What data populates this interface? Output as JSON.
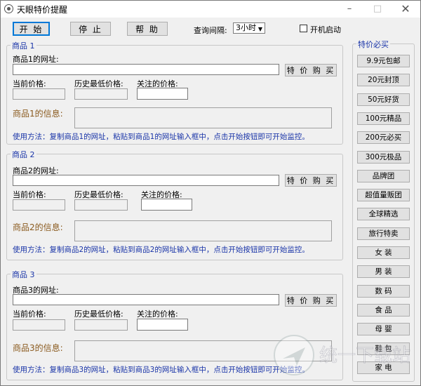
{
  "window": {
    "title": "天眼特价提醒",
    "min": "–",
    "max": "□",
    "close": "✕"
  },
  "toolbar": {
    "start": "开 始",
    "stop": "停 止",
    "help": "帮 助",
    "interval_label": "查询间隔:",
    "interval_value": "3小时",
    "autostart_label": "开机启动",
    "autostart_checked": false
  },
  "products": [
    {
      "legend": "商品 1",
      "url_label": "商品1的网址:",
      "buy_button": "特 价 购 买",
      "current_price_label": "当前价格:",
      "lowest_price_label": "历史最低价格:",
      "watch_price_label": "关注的价格:",
      "info_label": "商品1的信息:",
      "usage": "使用方法：复制商品1的网址，粘贴到商品1的网址输入框中，点击开始按钮即可开始监控。"
    },
    {
      "legend": "商品 2",
      "url_label": "商品2的网址:",
      "buy_button": "特 价 购 买",
      "current_price_label": "当前价格:",
      "lowest_price_label": "历史最低价格:",
      "watch_price_label": "关注的价格:",
      "info_label": "商品2的信息:",
      "usage": "使用方法：复制商品2的网址，粘贴到商品2的网址输入框中，点击开始按钮即可开始监控。"
    },
    {
      "legend": "商品 3",
      "url_label": "商品3的网址:",
      "buy_button": "特 价 购 买",
      "current_price_label": "当前价格:",
      "lowest_price_label": "历史最低价格:",
      "watch_price_label": "关注的价格:",
      "info_label": "商品3的信息:",
      "usage": "使用方法：复制商品3的网址，粘贴到商品3的网址输入框中，点击开始按钮即可开始监控。"
    }
  ],
  "sidebar": {
    "title": "特价必买",
    "items": [
      "9.9元包邮",
      "20元封顶",
      "50元好货",
      "100元精品",
      "200元必买",
      "300元极品",
      "品牌团",
      "超值量贩团",
      "全球精选",
      "旅行特卖",
      "女 装",
      "男 装",
      "数 码",
      "食 品",
      "母 婴",
      "鞋 包",
      "家 电"
    ]
  },
  "watermark": {
    "text": "统一下载站"
  },
  "colors": {
    "legend": "#1a35a8",
    "info_label": "#8a5a1e",
    "usage": "#1a35a8",
    "focus": "#0078d7"
  }
}
